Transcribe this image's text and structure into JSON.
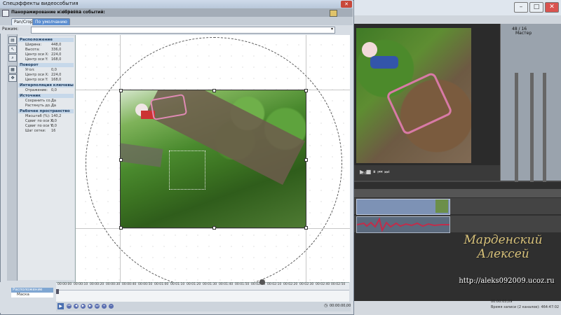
{
  "dialog": {
    "title": "Спецэффекты видеособытия",
    "close_label": "✕",
    "chain": {
      "label": "Панорамирование и обрезка событий:",
      "value": "16711694"
    },
    "tabs": [
      {
        "label": "Pan/Crop"
      },
      {
        "label": "По умолчанию"
      }
    ],
    "preset_label": "Режим:"
  },
  "properties": {
    "sections": [
      {
        "title": "Расположение",
        "rows": [
          {
            "key": "Ширина:",
            "value": "448,0"
          },
          {
            "key": "Высота:",
            "value": "336,0"
          },
          {
            "key": "Центр оси X:",
            "value": "224,0"
          },
          {
            "key": "Центр оси Y:",
            "value": "168,0"
          }
        ]
      },
      {
        "title": "Поворот",
        "rows": [
          {
            "key": "Угол:",
            "value": "0,0"
          },
          {
            "key": "Центр оси X:",
            "value": "224,0"
          },
          {
            "key": "Центр оси Y:",
            "value": "168,0"
          }
        ]
      },
      {
        "title": "Интерполяция ключевых к...",
        "rows": [
          {
            "key": "Отражение:",
            "value": "0,0"
          }
        ]
      },
      {
        "title": "Источник",
        "rows": [
          {
            "key": "Сохранить со...",
            "value": "Да"
          },
          {
            "key": "Растянуть до...",
            "value": "Да"
          }
        ]
      },
      {
        "title": "Рабочее пространство",
        "rows": [
          {
            "key": "Масштаб (%):",
            "value": "140,2"
          },
          {
            "key": "Сдвиг по оси X:",
            "value": "0,0"
          },
          {
            "key": "Сдвиг по оси Y:",
            "value": "0,0"
          },
          {
            "key": "Шаг сетки:",
            "value": "16"
          }
        ]
      }
    ]
  },
  "keyframes": {
    "list_header": "Расположение",
    "list_item": "Маска",
    "ticks": [
      "00:00:00",
      "00:00:10",
      "00:00:20",
      "00:00:30",
      "00:00:40",
      "00:00:50",
      "00:01:00",
      "00:01:10",
      "00:01:20",
      "00:01:30",
      "00:01:40",
      "00:01:50",
      "00:02:00",
      "00:02:10",
      "00:02:20",
      "00:02:30",
      "00:02:40",
      "00:02:50"
    ],
    "time": "00:00:00,00"
  },
  "background_app": {
    "tracks_time": "8:04",
    "meters_title": "48 / 16",
    "master_label": "Мастер",
    "status_time": "00:00:05,09",
    "status_text": "Время записи (2 каналов): 464:47:02"
  },
  "watermark": {
    "name_line1": "Марденский",
    "name_line2": "Алексей",
    "url": "http://aleks092009.ucoz.ru"
  },
  "colors": {
    "accent": "#3f6fb5",
    "clip_video": "#7d92b5",
    "audio_wave": "#c02d4b",
    "watermark_gold": "#d8c27a"
  }
}
